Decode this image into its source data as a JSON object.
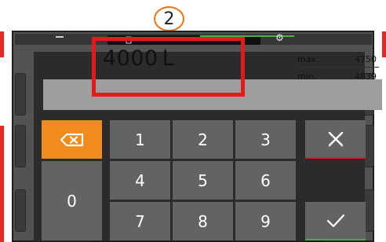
{
  "callout": {
    "number": "2"
  },
  "display": {
    "value": "4000",
    "unit": "L",
    "max_label": "max.",
    "max_value": "4750",
    "min_label": "min.",
    "min_value": "4839"
  },
  "keypad": {
    "digits": [
      "1",
      "2",
      "3",
      "4",
      "5",
      "6",
      "7",
      "8",
      "9",
      "0"
    ],
    "backspace_icon": "backspace-icon",
    "cancel_icon": "close-icon",
    "confirm_icon": "check-icon"
  },
  "colors": {
    "accent_orange": "#f08b1d",
    "cancel_red": "#d42020",
    "confirm_green": "#3db24b",
    "highlight_red": "#e31b1b",
    "callout_orange": "#ea7317"
  }
}
